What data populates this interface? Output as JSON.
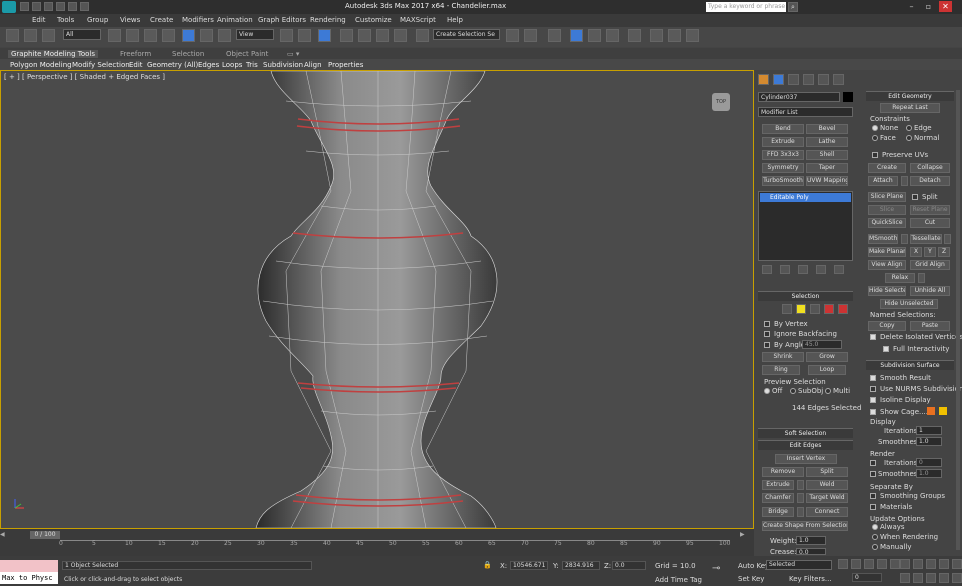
{
  "window": {
    "title": "Autodesk 3ds Max 2017 x64 - Chandelier.max",
    "search_placeholder": "Type a keyword or phrase"
  },
  "menu": [
    "Edit",
    "Tools",
    "Group",
    "Views",
    "Create",
    "Modifiers",
    "Animation",
    "Graph Editors",
    "Rendering",
    "Customize",
    "MAXScript",
    "Help"
  ],
  "toolbar": {
    "filter": "All",
    "ref_coord": "View",
    "named_set": "Create Selection Se"
  },
  "ribbon": {
    "tabs": [
      "Graphite Modeling Tools",
      "Freeform",
      "Selection",
      "Object Paint"
    ],
    "subtabs": [
      "Polygon Modeling",
      "Modify Selection",
      "Edit",
      "Geometry (All)",
      "Edges",
      "Loops",
      "Tris",
      "Subdivision",
      "Align",
      "Properties"
    ]
  },
  "viewport": {
    "label": "[ + ] [ Perspective ] [ Shaded + Edged Faces ]",
    "viewcube": "TOP"
  },
  "modify": {
    "object_name": "Cylinder037",
    "modifier_list": "Modifier List",
    "modbuttons": [
      "Bend",
      "Bevel",
      "Extrude",
      "Lathe",
      "FFD 3x3x3",
      "Shell",
      "Symmetry",
      "Taper",
      "TurboSmooth",
      "UVW Mapping Cle"
    ],
    "stack_item": "Editable Poly",
    "selection": {
      "header": "Selection",
      "by_vertex": "By Vertex",
      "ignore_backfacing": "Ignore Backfacing",
      "by_angle": "By Angle:",
      "angle": "45.0",
      "shrink": "Shrink",
      "grow": "Grow",
      "ring": "Ring",
      "loop": "Loop",
      "preview": "Preview Selection",
      "off": "Off",
      "subobj": "SubObj",
      "multi": "Multi",
      "status": "144 Edges Selected"
    },
    "soft_selection": "Soft Selection",
    "edit_edges": {
      "header": "Edit Edges",
      "insert_vertex": "Insert Vertex",
      "remove": "Remove",
      "split": "Split",
      "extrude": "Extrude",
      "weld": "Weld",
      "chamfer": "Chamfer",
      "target_weld": "Target Weld",
      "bridge": "Bridge",
      "connect": "Connect",
      "create_shape": "Create Shape From Selection",
      "weight_label": "Weight:",
      "weight": "1.0",
      "crease_label": "Crease:",
      "crease": "0.0"
    }
  },
  "edit_geometry": {
    "header": "Edit Geometry",
    "repeat_last": "Repeat Last",
    "constraints": "Constraints",
    "none": "None",
    "edge": "Edge",
    "face": "Face",
    "normal": "Normal",
    "preserve_uvs": "Preserve UVs",
    "create": "Create",
    "collapse": "Collapse",
    "attach": "Attach",
    "detach": "Detach",
    "slice_plane": "Slice Plane",
    "split": "Split",
    "slice": "Slice",
    "reset_plane": "Reset Plane",
    "quickslice": "QuickSlice",
    "cut": "Cut",
    "msmooth": "MSmooth",
    "tessellate": "Tessellate",
    "make_planar": "Make Planar",
    "x": "X",
    "y": "Y",
    "z": "Z",
    "view_align": "View Align",
    "grid_align": "Grid Align",
    "relax": "Relax",
    "hide_selected": "Hide Selected",
    "unhide_all": "Unhide All",
    "hide_unselected": "Hide Unselected",
    "named_selections": "Named Selections:",
    "copy": "Copy",
    "paste": "Paste",
    "delete_isolated": "Delete Isolated Vertices",
    "full_interactivity": "Full Interactivity"
  },
  "subdivision": {
    "header": "Subdivision Surface",
    "smooth_result": "Smooth Result",
    "use_nurms": "Use NURMS Subdivision",
    "isoline": "Isoline Display",
    "show_cage": "Show Cage......",
    "display": "Display",
    "iterations_label": "Iterations:",
    "iterations": "1",
    "smoothness_label": "Smoothness:",
    "smoothness": "1.0",
    "render": "Render",
    "r_iterations": "0",
    "r_smoothness": "1.0",
    "separate_by": "Separate By",
    "smoothing_groups": "Smoothing Groups",
    "materials": "Materials",
    "update_options": "Update Options",
    "always": "Always",
    "when_rendering": "When Rendering",
    "manually": "Manually"
  },
  "timeline": {
    "slider": "0 / 100",
    "ticks": [
      "0",
      "5",
      "10",
      "15",
      "20",
      "25",
      "30",
      "35",
      "40",
      "45",
      "50",
      "55",
      "60",
      "65",
      "70",
      "75",
      "80",
      "85",
      "90",
      "95",
      "100"
    ]
  },
  "status": {
    "maxscript": "Max to Physc",
    "selected": "1 Object Selected",
    "prompt": "Click or click-and-drag to select objects",
    "x_label": "X:",
    "x": "10546.671",
    "y_label": "Y:",
    "y": "2834.916",
    "z_label": "Z:",
    "z": "0.0",
    "grid": "Grid = 10.0",
    "add_time_tag": "Add Time Tag",
    "auto_key": "Auto Key",
    "set_key": "Set Key",
    "key_mode": "Selected",
    "key_filters": "Key Filters...",
    "frame": "0"
  },
  "colors": {
    "accent": "#3d7ad6",
    "selection_edge": "#c04040",
    "viewport_border": "#c8a000",
    "cage1": "#e87020",
    "cage2": "#f0c000"
  }
}
